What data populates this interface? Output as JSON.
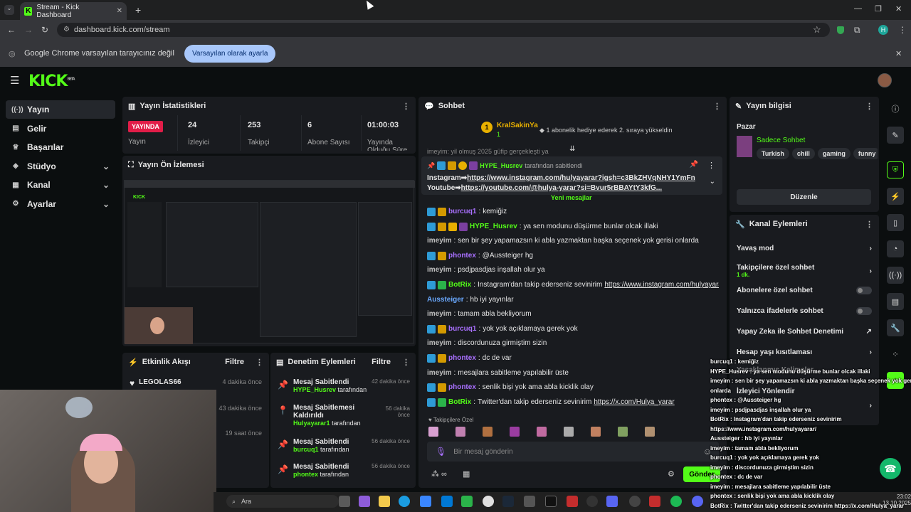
{
  "browser": {
    "tab_title": "Stream - Kick Dashboard",
    "url": "dashboard.kick.com/stream",
    "infobar_text": "Google Chrome varsayılan tarayıcınız değil",
    "infobar_button": "Varsayılan olarak ayarla",
    "profile_initial": "H"
  },
  "header": {
    "logo": "KICK",
    "beta": "BETA"
  },
  "sidebar": {
    "items": [
      {
        "label": "Yayın",
        "icon": "broadcast-icon"
      },
      {
        "label": "Gelir",
        "icon": "wallet-icon"
      },
      {
        "label": "Başarılar",
        "icon": "trophy-icon"
      },
      {
        "label": "Stüdyo",
        "icon": "studio-icon"
      },
      {
        "label": "Kanal",
        "icon": "channel-icon"
      },
      {
        "label": "Ayarlar",
        "icon": "gear-icon"
      }
    ]
  },
  "stats": {
    "title": "Yayın İstatistikleri",
    "live_badge": "YAYINDA",
    "live_label": "Yayın",
    "viewers": "24",
    "viewers_label": "İzleyici",
    "followers": "253",
    "followers_label": "Takipçi",
    "subs": "6",
    "subs_label": "Abone Sayısı",
    "uptime": "01:00:03",
    "uptime_label": "Yayında Olduğu Süre"
  },
  "preview": {
    "title": "Yayın Ön İzlemesi"
  },
  "activity": {
    "title": "Etkinlik Akışı",
    "filter": "Filtre",
    "items": [
      {
        "name": "LEGOLAS66",
        "time": "4 dakika önce"
      },
      {
        "name": "",
        "time": "43 dakika önce"
      },
      {
        "name": "",
        "time": "19 saat önce"
      }
    ]
  },
  "modlog": {
    "title": "Denetim Eylemleri",
    "filter": "Filtre",
    "items": [
      {
        "action": "Mesaj Sabitlendi",
        "user": "HYPE_Husrev",
        "suffix": "tarafından",
        "time": "42 dakika önce"
      },
      {
        "action": "Mesaj Sabitlemesi Kaldırıldı",
        "user": "Hulyayarar1",
        "suffix": "tarafından",
        "time": "56 dakika önce"
      },
      {
        "action": "Mesaj Sabitlendi",
        "user": "burcuq1",
        "suffix": "tarafından",
        "time": "56 dakika önce"
      },
      {
        "action": "Mesaj Sabitlendi",
        "user": "phontex",
        "suffix": "tarafından",
        "time": "56 dakika önce"
      }
    ]
  },
  "chat": {
    "title": "Sohbet",
    "top_gifter": "KralSakinYa",
    "top_gifter_count": "1",
    "gift_text": "1 abonelik hediye ederek 2. sıraya yükseldin",
    "partial_line": "imeyim: yil olmuş 2025 güfip gerçekleşti ya",
    "pinned_by": "HYPE_Husrev",
    "pinned_suffix": "tarafından sabitlendi",
    "pinned_line1_prefix": "Instagram➡",
    "pinned_line1_link": "https://www.instagram.com/hulyayarar?igsh=c3BkZHVqNHY1YmFn",
    "pinned_line2_prefix": "Youtube➡",
    "pinned_line2_link": "https://youtube.com/@hulya-yarar?si=Bvur5rBBAYtY3kfG...",
    "new_messages": "Yeni mesajlar",
    "messages": [
      {
        "user": "burcuq1",
        "color": "#a970ff",
        "text": "kemiğiz",
        "badges": [
          "#2e9bd6",
          "#d49a00"
        ]
      },
      {
        "user": "HYPE_Husrev",
        "color": "#53fc18",
        "text": "ya sen modunu düşürme bunlar olcak illaki",
        "badges": [
          "#2e9bd6",
          "#d49a00",
          "#e8b000",
          "#7b3fa0"
        ]
      },
      {
        "user": "imeyim",
        "color": "#c0c0c0",
        "text": "sen bir şey yapamazsın ki abla yazmaktan başka seçenek yok gerisi onlarda",
        "badges": []
      },
      {
        "user": "phontex",
        "color": "#a970ff",
        "text": "@Aussteiger hg",
        "badges": [
          "#2e9bd6",
          "#d49a00"
        ]
      },
      {
        "user": "imeyim",
        "color": "#c0c0c0",
        "text": "psdjpasdjas inşallah olur ya",
        "badges": []
      },
      {
        "user": "BotRix",
        "color": "#53fc18",
        "text": "Instagram'dan takip ederseniz sevinirim",
        "link": "https://www.instagram.com/hulyayarar/",
        "badges": [
          "#2e9bd6",
          "#2bb34a"
        ]
      },
      {
        "user": "Aussteiger",
        "color": "#6aa9ff",
        "text": "hb iyi yayınlar",
        "badges": []
      },
      {
        "user": "imeyim",
        "color": "#c0c0c0",
        "text": "tamam abla bekliyorum",
        "badges": []
      },
      {
        "user": "burcuq1",
        "color": "#a970ff",
        "text": "yok yok açıklamaya gerek yok",
        "badges": [
          "#2e9bd6",
          "#d49a00"
        ]
      },
      {
        "user": "imeyim",
        "color": "#c0c0c0",
        "text": "discordunuza girmiştim sizin",
        "badges": []
      },
      {
        "user": "phontex",
        "color": "#a970ff",
        "text": "dc de var",
        "badges": [
          "#2e9bd6",
          "#d49a00"
        ]
      },
      {
        "user": "imeyim",
        "color": "#c0c0c0",
        "text": "mesajlara sabitleme yapılabilir üste",
        "badges": []
      },
      {
        "user": "phontex",
        "color": "#a970ff",
        "text": "senlik bişi yok ama abla kicklik olay",
        "badges": [
          "#2e9bd6",
          "#d49a00"
        ]
      },
      {
        "user": "BotRix",
        "color": "#53fc18",
        "text": "Twitter'dan takip ederseniz sevinirim",
        "link": "https://x.com/Hulya_yarar",
        "badges": [
          "#2e9bd6",
          "#2bb34a"
        ]
      }
    ],
    "emote_label": "Takipçilere Özel",
    "placeholder": "Bir mesaj gönderin",
    "send": "Gönder"
  },
  "streaminfo": {
    "title": "Yayın bilgisi",
    "category": "Pazar",
    "stream_title": "Sadece Sohbet",
    "tags": [
      "Turkish",
      "chill",
      "gaming",
      "funny"
    ],
    "edit": "Düzenle"
  },
  "channel_actions": {
    "title": "Kanal Eylemleri",
    "slow_mode": "Yavaş mod",
    "followers_only": "Takipçilere özel sohbet",
    "followers_only_sub": "1 dk.",
    "subs_only": "Abonelere özel sohbet",
    "emote_only": "Yalnızca ifadelerle sohbet",
    "ai_mod": "Yapay Zeka ile Sohbet Denetimi",
    "age": "Hesap yaşı kısıtlaması",
    "banned_words": "Yasaklanmış Kelimeler",
    "viewer_redirect": "İzleyici Yönlendir"
  },
  "overlay_chat": [
    "burcuq1 : kemiğiz",
    "HYPE_Husrev : ya sen modunu düşürme bunlar olcak illaki",
    "imeyim : sen bir şey yapamazsın ki abla yazmaktan başka seçenek yok gerisi",
    "onlarda",
    "phontex : @Aussteiger hg",
    "imeyim : psdjpasdjas inşallah olur ya",
    "BotRix : Instagram'dan takip ederseniz sevinirim",
    "https://www.instagram.com/hulyayarar/",
    "Aussteiger : hb iyi yayınlar",
    "imeyim : tamam abla bekliyorum",
    "burcuq1 : yok yok açıklamaya gerek yok",
    "imeyim : discordunuza girmiştim sizin",
    "phontex : dc de var",
    "imeyim : mesajlara sabitleme yapılabilir üste",
    "phontex : senlik bişi yok ama abla kicklik olay",
    "BotRix : Twitter'dan takip ederseniz sevinirim https://x.com/Hulya_yarar"
  ],
  "taskbar": {
    "search": "Ara",
    "time": "23:02",
    "date": "13.10.2025"
  }
}
